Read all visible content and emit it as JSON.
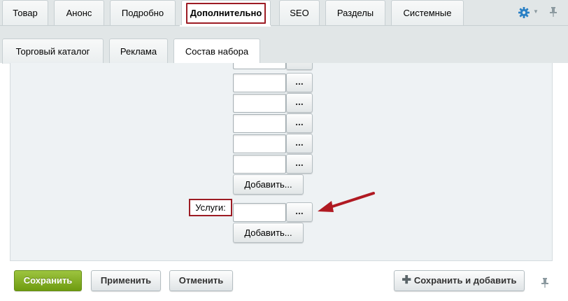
{
  "tabs_row1": [
    {
      "label": "Товар"
    },
    {
      "label": "Анонс"
    },
    {
      "label": "Подробно"
    },
    {
      "label": "Дополнительно",
      "active": true
    },
    {
      "label": "SEO"
    },
    {
      "label": "Разделы"
    },
    {
      "label": "Системные"
    }
  ],
  "tabs_row2": [
    {
      "label": "Торговый каталог"
    },
    {
      "label": "Реклама"
    },
    {
      "label": "Состав набора"
    }
  ],
  "settings_icon": "gear-icon",
  "pin_icon": "pin-icon",
  "form": {
    "browse_label": "...",
    "add_label": "Добавить...",
    "services_label": "Услуги:"
  },
  "footer": {
    "save": "Сохранить",
    "apply": "Применить",
    "cancel": "Отменить",
    "save_and_add": "Сохранить и добавить",
    "plus_icon": "plus-icon"
  },
  "colors": {
    "highlight": "#9d1c24",
    "save_green": "#7aa51b",
    "arrow": "#b01a22"
  }
}
